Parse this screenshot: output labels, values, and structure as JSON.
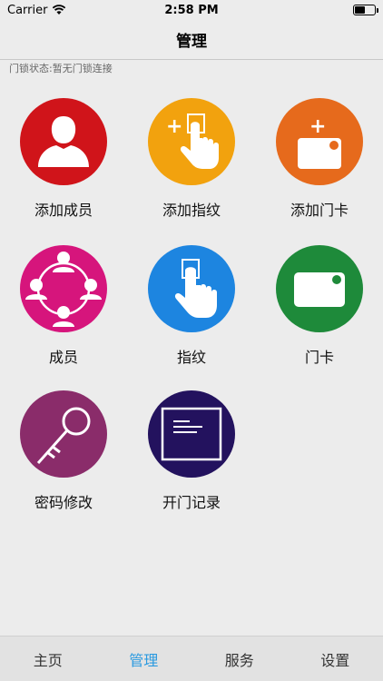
{
  "status_bar": {
    "carrier": "Carrier",
    "time": "2:58 PM"
  },
  "nav": {
    "title": "管理"
  },
  "lock_status": "门锁状态:暂无门锁连接",
  "tiles": [
    {
      "label": "添加成员",
      "color": "#d0141a",
      "icon": "add-member-icon"
    },
    {
      "label": "添加指纹",
      "color": "#f2a20e",
      "icon": "add-fingerprint-icon"
    },
    {
      "label": "添加门卡",
      "color": "#e66a1c",
      "icon": "add-card-icon"
    },
    {
      "label": "成员",
      "color": "#d6157c",
      "icon": "members-icon"
    },
    {
      "label": "指纹",
      "color": "#1d85e0",
      "icon": "fingerprint-icon"
    },
    {
      "label": "门卡",
      "color": "#1e8a3a",
      "icon": "card-icon"
    },
    {
      "label": "密码修改",
      "color": "#8a2c6a",
      "icon": "key-icon"
    },
    {
      "label": "开门记录",
      "color": "#23125e",
      "icon": "record-icon"
    }
  ],
  "tabs": [
    {
      "label": "主页",
      "active": false
    },
    {
      "label": "管理",
      "active": true
    },
    {
      "label": "服务",
      "active": false
    },
    {
      "label": "设置",
      "active": false
    }
  ],
  "colors": {
    "tab_active": "#2a9ae0",
    "background": "#ececec"
  }
}
